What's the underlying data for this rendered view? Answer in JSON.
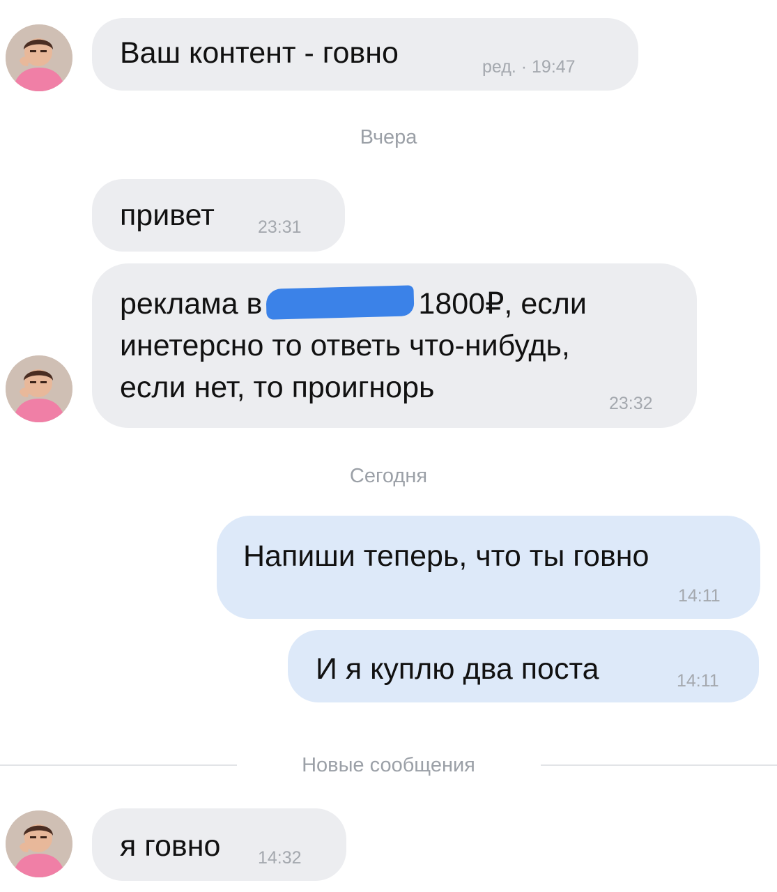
{
  "messages": [
    {
      "text": "Ваш контент - говно",
      "time": "ред. · 19:47"
    },
    {
      "text": "привет",
      "time": "23:31"
    },
    {
      "line1_before": "реклама в",
      "line1_after": "1800₽, если",
      "line2": "инетерсно то ответь что-нибудь,",
      "line3": "если нет, то проигнорь",
      "time": "23:32"
    },
    {
      "text": "Напиши теперь, что ты говно",
      "time": "14:11"
    },
    {
      "text": "И я куплю два поста",
      "time": "14:11"
    },
    {
      "text": "я говно",
      "time": "14:32"
    }
  ],
  "dividers": {
    "yesterday": "Вчера",
    "today": "Сегодня",
    "new_messages": "Новые сообщения"
  },
  "colors": {
    "incoming_bubble": "#ecedf0",
    "outgoing_bubble": "#dde9f9",
    "redaction": "#3b82e8"
  }
}
